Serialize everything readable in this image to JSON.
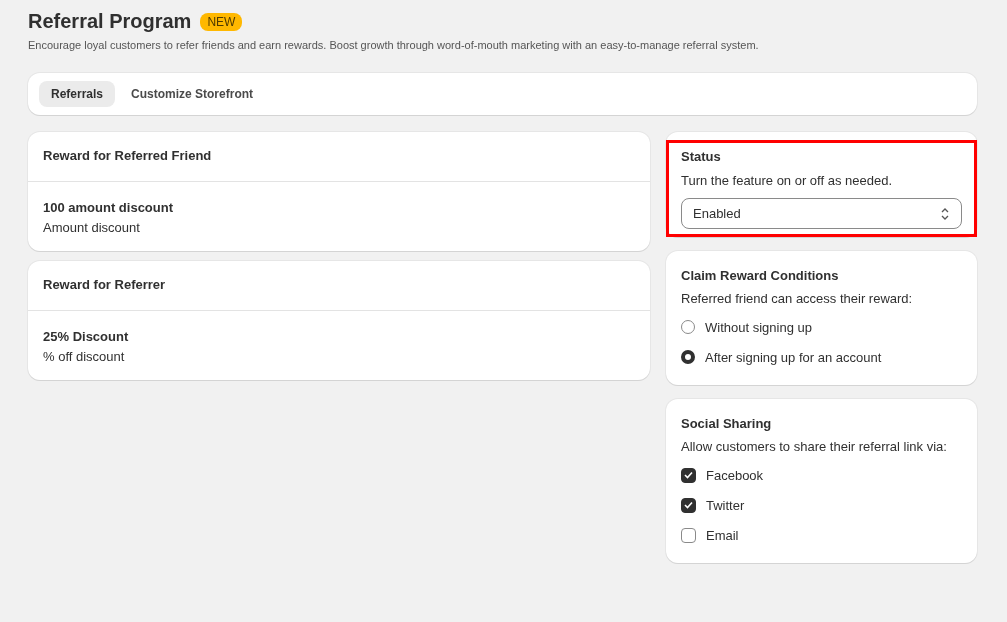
{
  "header": {
    "title": "Referral Program",
    "badge": "NEW",
    "description": "Encourage loyal customers to refer friends and earn rewards. Boost growth through word-of-mouth marketing with an easy-to-manage referral system."
  },
  "tabs": [
    {
      "label": "Referrals",
      "selected": true
    },
    {
      "label": "Customize Storefront",
      "selected": false
    }
  ],
  "rewards": [
    {
      "title": "Reward for Referred Friend",
      "name": "100 amount discount",
      "type": "Amount discount"
    },
    {
      "title": "Reward for Referrer",
      "name": "25% Discount",
      "type": "% off discount"
    }
  ],
  "status": {
    "title": "Status",
    "description": "Turn the feature on or off as needed.",
    "value": "Enabled",
    "highlighted": true
  },
  "claim_conditions": {
    "title": "Claim Reward Conditions",
    "description": "Referred friend can access their reward:",
    "options": [
      {
        "label": "Without signing up",
        "selected": false
      },
      {
        "label": "After signing up for an account",
        "selected": true
      }
    ]
  },
  "social_sharing": {
    "title": "Social Sharing",
    "description": "Allow customers to share their referral link via:",
    "options": [
      {
        "label": "Facebook",
        "checked": true
      },
      {
        "label": "Twitter",
        "checked": true
      },
      {
        "label": "Email",
        "checked": false
      }
    ]
  }
}
